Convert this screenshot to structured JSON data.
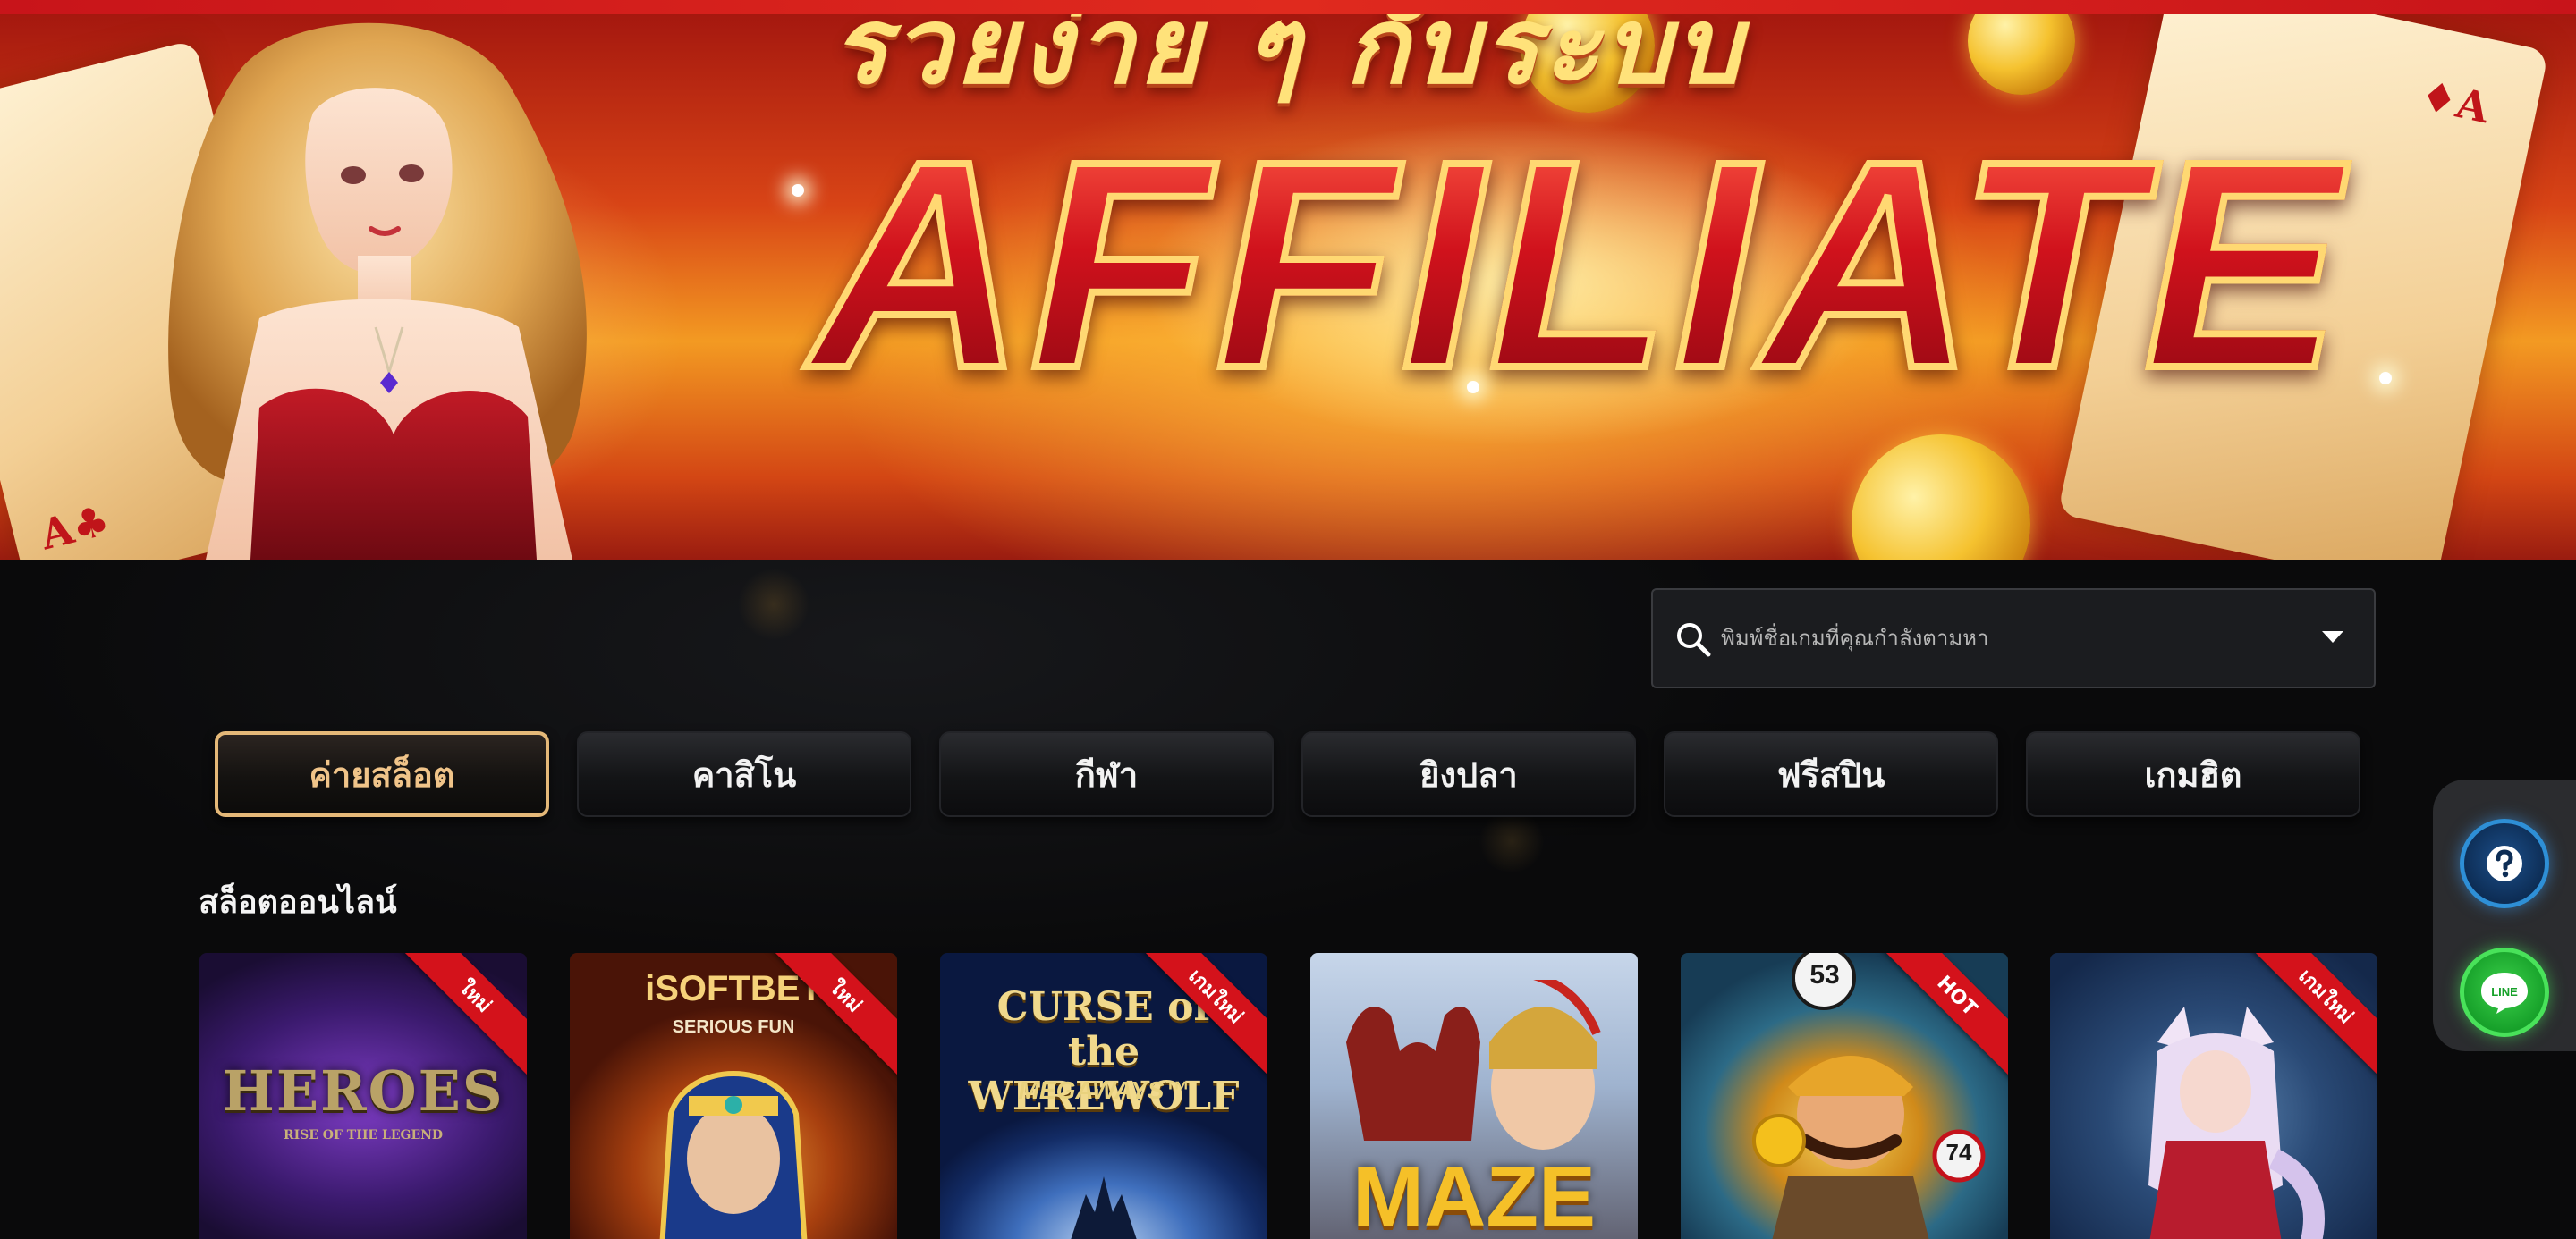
{
  "hero": {
    "headline": "รวยง่าย ๆ กับระบบ",
    "title": "AFFILIATE",
    "card_suit_left": "A♣",
    "card_suit_right": "♦A"
  },
  "search": {
    "placeholder": "พิมพ์ชื่อเกมที่คุณกำลังตามหา",
    "value": ""
  },
  "tabs": [
    {
      "label": "ค่ายสล็อต",
      "active": true
    },
    {
      "label": "คาสิโน",
      "active": false
    },
    {
      "label": "กีฬา",
      "active": false
    },
    {
      "label": "ยิงปลา",
      "active": false
    },
    {
      "label": "ฟรีสปิน",
      "active": false
    },
    {
      "label": "เกมฮิต",
      "active": false
    }
  ],
  "section": {
    "title": "สล็อตออนไลน์"
  },
  "games": [
    {
      "logo": "HEROES",
      "sublogo": "RISE OF THE LEGEND",
      "badge": "ใหม่"
    },
    {
      "logo": "iSOFTBET",
      "sublogo": "SERIOUS FUN",
      "badge": "ใหม่"
    },
    {
      "logo": "CURSE of the WEREWOLF",
      "sublogo": "MEGAWAYS™",
      "badge": "เกมใหม่"
    },
    {
      "logo": "MAZE",
      "sublogo": "",
      "badge": ""
    },
    {
      "logo": "53",
      "sublogo": "74",
      "badge": "HOT"
    },
    {
      "logo": "",
      "sublogo": "",
      "badge": "เกมใหม่"
    }
  ],
  "dock": {
    "help_icon": "question-mark-icon",
    "line_icon": "line-chat-icon",
    "line_label": "LINE"
  },
  "colors": {
    "accent_gold": "#e4b878",
    "ribbon_red": "#d4121b",
    "help_blue": "#2e8fd6",
    "line_green": "#49e25a"
  }
}
